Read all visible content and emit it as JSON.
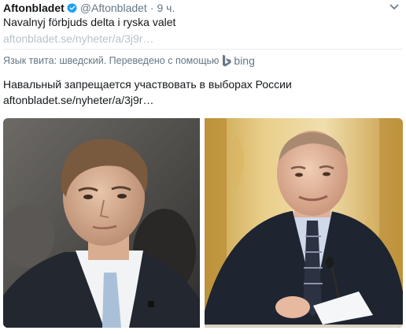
{
  "tweet": {
    "author_name": "Aftonbladet",
    "handle": "@Aftonbladet",
    "separator": "·",
    "time": "9 ч.",
    "text": "Navalnyj förbjuds delta i ryska valet",
    "link": "aftonbladet.se/nyheter/a/3j9r…",
    "translation_note": "Язык твита: шведский. Переведено с помощью",
    "translation_provider": "bing",
    "translated_text": "Навальный запрещается участвовать в выборах России",
    "translated_link": "aftonbladet.se/nyheter/a/3j9r…"
  },
  "colors": {
    "verified_badge": "#1da1f2",
    "muted_text": "#657786",
    "faded_link": "#b7c3cc"
  },
  "icons": {
    "verified": "verified-badge-icon",
    "caret": "chevron-down-icon",
    "bing": "bing-logo-icon"
  }
}
